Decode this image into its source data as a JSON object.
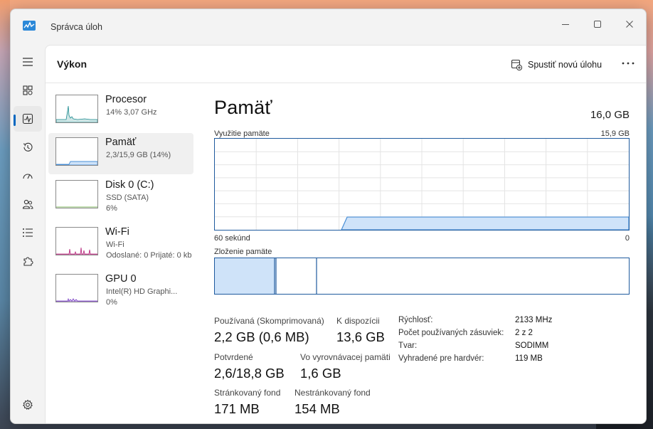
{
  "app": {
    "title": "Správca úloh"
  },
  "header": {
    "title": "Výkon",
    "run_task_label": "Spustiť novú úlohu"
  },
  "side": {
    "items": [
      {
        "name": "Procesor",
        "sub1": "14% 3,07 GHz",
        "sub2": ""
      },
      {
        "name": "Pamäť",
        "sub1": "2,3/15,9 GB (14%)",
        "sub2": ""
      },
      {
        "name": "Disk 0 (C:)",
        "sub1": "SSD (SATA)",
        "sub2": "6%"
      },
      {
        "name": "Wi-Fi",
        "sub1": "Wi-Fi",
        "sub2": "Odoslané: 0 Prijaté: 0 kb"
      },
      {
        "name": "GPU 0",
        "sub1": "Intel(R) HD Graphi...",
        "sub2": "0%"
      }
    ]
  },
  "memory": {
    "title": "Pamäť",
    "total": "16,0 GB",
    "usage_label": "Využitie pamäte",
    "usage_max": "15,9 GB",
    "time_left": "60 sekúnd",
    "time_right": "0",
    "composition_label": "Zloženie pamäte",
    "usage_fraction": 0.14,
    "stats": {
      "in_use_label": "Používaná (Skomprimovaná)",
      "in_use_value": "2,2 GB (0,6 MB)",
      "available_label": "K dispozícii",
      "available_value": "13,6 GB",
      "committed_label": "Potvrdené",
      "committed_value": "2,6/18,8 GB",
      "cached_label": "Vo vyrovnávacej pamäti",
      "cached_value": "1,6 GB",
      "paged_label": "Stránkovaný fond",
      "paged_value": "171 MB",
      "nonpaged_label": "Nestránkovaný fond",
      "nonpaged_value": "154 MB"
    },
    "details": [
      {
        "key": "Rýchlosť:",
        "value": "2133 MHz"
      },
      {
        "key": "Počet používaných zásuviek:",
        "value": "2 z 2"
      },
      {
        "key": "Tvar:",
        "value": "SODIMM"
      },
      {
        "key": "Vyhradené pre hardvér:",
        "value": "119 MB"
      }
    ]
  },
  "colors": {
    "accent": "#0067c0",
    "memory_line": "#4a8fd6",
    "memory_fill": "#cfe3f9",
    "graph_border": "#1e5a9e",
    "cpu": "#1a8a8f",
    "wifi": "#b5237a",
    "gpu": "#7a3fc4"
  }
}
